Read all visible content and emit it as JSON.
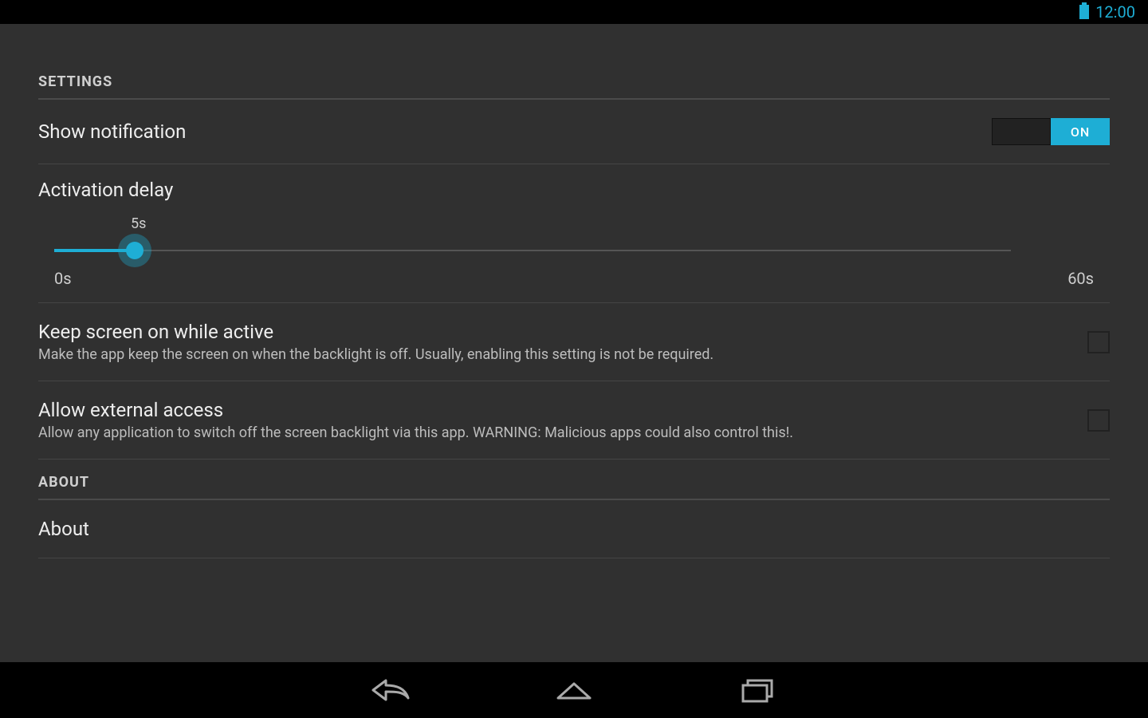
{
  "status_bar": {
    "clock": "12:00"
  },
  "sections": {
    "settings_header": "SETTINGS",
    "about_header": "ABOUT"
  },
  "settings": {
    "show_notification": {
      "title": "Show notification",
      "toggle_label": "ON"
    },
    "activation_delay": {
      "title": "Activation delay",
      "value_label": "5s",
      "min_label": "0s",
      "max_label": "60s",
      "value": 5,
      "min": 0,
      "max": 60
    },
    "keep_screen_on": {
      "title": "Keep screen on while active",
      "subtitle": "Make the app keep the screen on when the backlight is off. Usually, enabling this setting is not be required.",
      "checked": false
    },
    "allow_external_access": {
      "title": "Allow external access",
      "subtitle": "Allow any application to switch off the screen backlight via this app. WARNING: Malicious apps could also control this!.",
      "checked": false
    }
  },
  "about": {
    "title": "About"
  },
  "colors": {
    "accent": "#1eaed5",
    "background": "#303030",
    "black": "#000000"
  }
}
